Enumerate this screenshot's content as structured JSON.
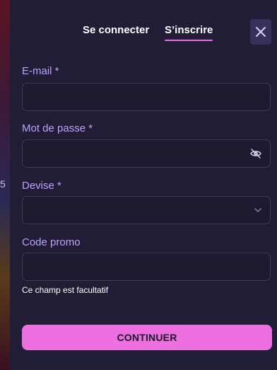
{
  "tabs": {
    "login": "Se connecter",
    "signup": "S’inscrire",
    "active": "signup"
  },
  "close_icon": "close-icon",
  "fields": {
    "email": {
      "label": "E-mail *",
      "value": "",
      "placeholder": ""
    },
    "password": {
      "label": "Mot de passe *",
      "value": "",
      "placeholder": "",
      "icon": "eye-off-icon"
    },
    "currency": {
      "label": "Devise *",
      "value": "",
      "icon": "chevron-down-icon"
    },
    "promo": {
      "label": "Code promo",
      "value": "",
      "placeholder": "",
      "helper": "Ce champ est facultatif"
    }
  },
  "continue_label": "CONTINUER",
  "background_glyph": "5",
  "colors": {
    "accent": "#ee6fe0",
    "label": "#b9a4ff",
    "modal_bg": "#221d36",
    "field_border": "#3f3a58"
  }
}
